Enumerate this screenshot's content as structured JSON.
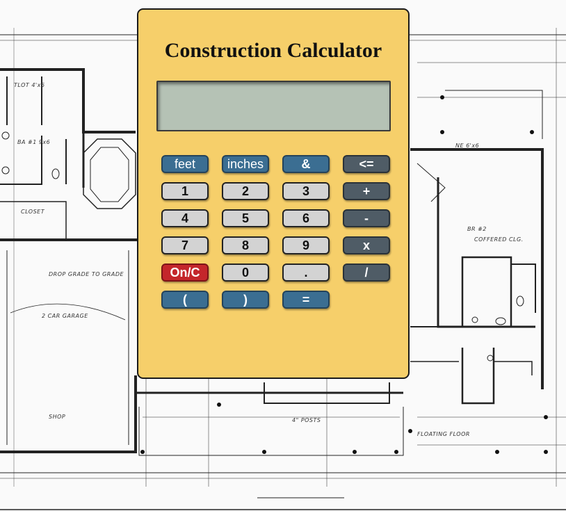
{
  "calculator": {
    "title": "Construction Calculator",
    "display_value": "",
    "buttons": {
      "feet": "feet",
      "inches": "inches",
      "amp": "&",
      "backspace": "<=",
      "one": "1",
      "two": "2",
      "three": "3",
      "plus": "+",
      "four": "4",
      "five": "5",
      "six": "6",
      "minus": "-",
      "seven": "7",
      "eight": "8",
      "nine": "9",
      "times": "x",
      "onc": "On/C",
      "zero": "0",
      "dot": ".",
      "divide": "/",
      "lparen": "(",
      "rparen": ")",
      "equals": "="
    },
    "colors": {
      "body": "#f6cf6a",
      "unit_button": "#3b6e92",
      "digit_button": "#d3d3d3",
      "operator_button": "#4f5c66",
      "clear_button": "#c4262b",
      "display": "#b5c2b5"
    }
  }
}
